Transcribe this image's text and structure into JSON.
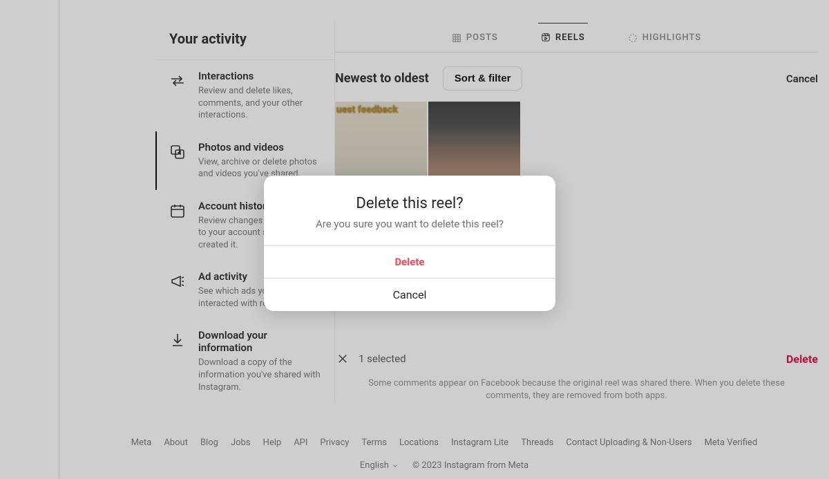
{
  "sidebar": {
    "title": "Your activity",
    "items": [
      {
        "title": "Interactions",
        "desc": "Review and delete likes, comments, and your other interactions."
      },
      {
        "title": "Photos and videos",
        "desc": "View, archive or delete photos and videos you've shared."
      },
      {
        "title": "Account history",
        "desc": "Review changes you've made to your account since you created it."
      },
      {
        "title": "Ad activity",
        "desc": "See which ads you've interacted with recently."
      },
      {
        "title": "Download your information",
        "desc": "Download a copy of the information you've shared with Instagram."
      }
    ]
  },
  "tabs": {
    "posts": "POSTS",
    "reels": "REELS",
    "highlights": "HIGHLIGHTS"
  },
  "controls": {
    "sort_label": "Newest to oldest",
    "sort_filter": "Sort & filter",
    "cancel": "Cancel"
  },
  "thumbs": {
    "t1_overlay": "uest feedback"
  },
  "selection": {
    "count": "1 selected",
    "delete": "Delete",
    "note": "Some comments appear on Facebook because the original reel was shared there. When you delete these comments, they are removed from both apps."
  },
  "footer": {
    "links": [
      "Meta",
      "About",
      "Blog",
      "Jobs",
      "Help",
      "API",
      "Privacy",
      "Terms",
      "Locations",
      "Instagram Lite",
      "Threads",
      "Contact Uploading & Non-Users",
      "Meta Verified"
    ],
    "language": "English",
    "copyright": "© 2023 Instagram from Meta"
  },
  "modal": {
    "title": "Delete this reel?",
    "message": "Are you sure you want to delete this reel?",
    "delete": "Delete",
    "cancel": "Cancel"
  }
}
